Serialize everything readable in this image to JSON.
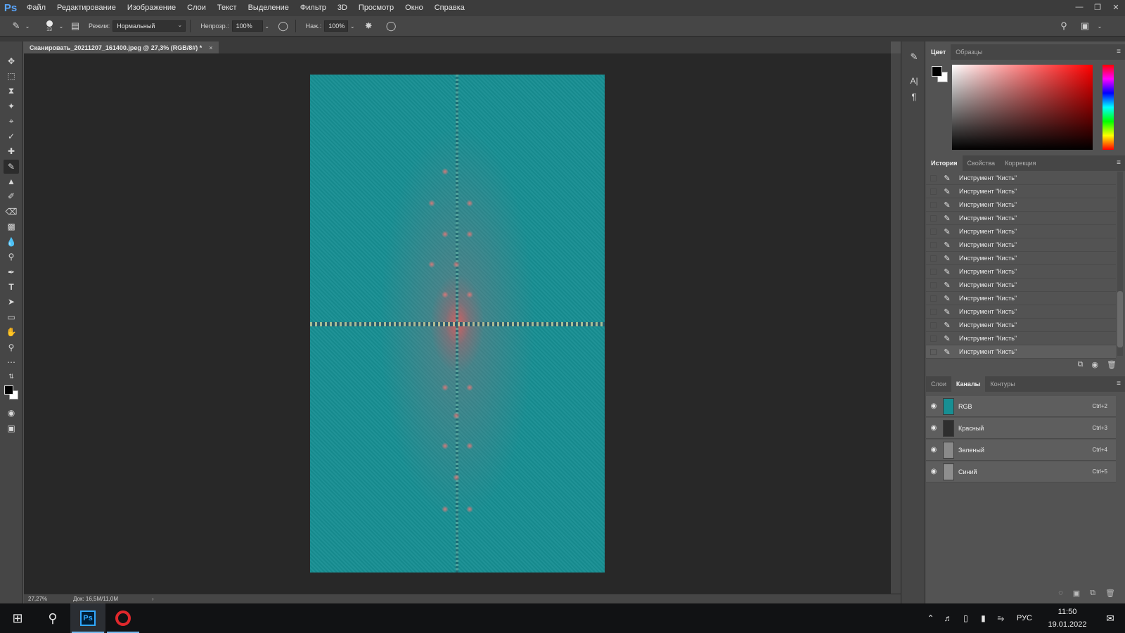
{
  "menubar": {
    "logo": "Ps",
    "items": [
      "Файл",
      "Редактирование",
      "Изображение",
      "Слои",
      "Текст",
      "Выделение",
      "Фильтр",
      "3D",
      "Просмотр",
      "Окно",
      "Справка"
    ]
  },
  "options": {
    "brush_size": "13",
    "mode_label": "Режим:",
    "mode_value": "Нормальный",
    "opacity_label": "Непрозр.:",
    "opacity_value": "100%",
    "pressure_label": "Наж.:",
    "pressure_value": "100%"
  },
  "document": {
    "tab_title": "Сканировать_20211207_161400.jpeg @ 27,3% (RGB/8#) *",
    "close": "×"
  },
  "status": {
    "zoom": "27,27%",
    "doc_size": "Док: 16,5M/11,0M",
    "arrow": "›"
  },
  "color_panel": {
    "tabs": [
      "Цвет",
      "Образцы"
    ],
    "active_tab": 0
  },
  "history_panel": {
    "tabs": [
      "История",
      "Свойства",
      "Коррекция"
    ],
    "items": [
      "Инструмент \"Кисть\"",
      "Инструмент \"Кисть\"",
      "Инструмент \"Кисть\"",
      "Инструмент \"Кисть\"",
      "Инструмент \"Кисть\"",
      "Инструмент \"Кисть\"",
      "Инструмент \"Кисть\"",
      "Инструмент \"Кисть\"",
      "Инструмент \"Кисть\"",
      "Инструмент \"Кисть\"",
      "Инструмент \"Кисть\"",
      "Инструмент \"Кисть\"",
      "Инструмент \"Кисть\"",
      "Инструмент \"Кисть\""
    ]
  },
  "channels_panel": {
    "tabs": [
      "Слои",
      "Каналы",
      "Контуры"
    ],
    "channels": [
      {
        "name": "RGB",
        "shortcut": "Ctrl+2",
        "thumb": "#178f93"
      },
      {
        "name": "Красный",
        "shortcut": "Ctrl+3",
        "thumb": "#2e2e2e"
      },
      {
        "name": "Зеленый",
        "shortcut": "Ctrl+4",
        "thumb": "#8a8a8a"
      },
      {
        "name": "Синий",
        "shortcut": "Ctrl+5",
        "thumb": "#8e8e8e"
      }
    ]
  },
  "taskbar": {
    "lang": "РУС",
    "time": "11:50",
    "date": "19.01.2022",
    "ps_label": "Ps"
  },
  "colors": {
    "accent": "#31a8ff",
    "image_teal": "#178f93",
    "workspace": "#282828"
  }
}
